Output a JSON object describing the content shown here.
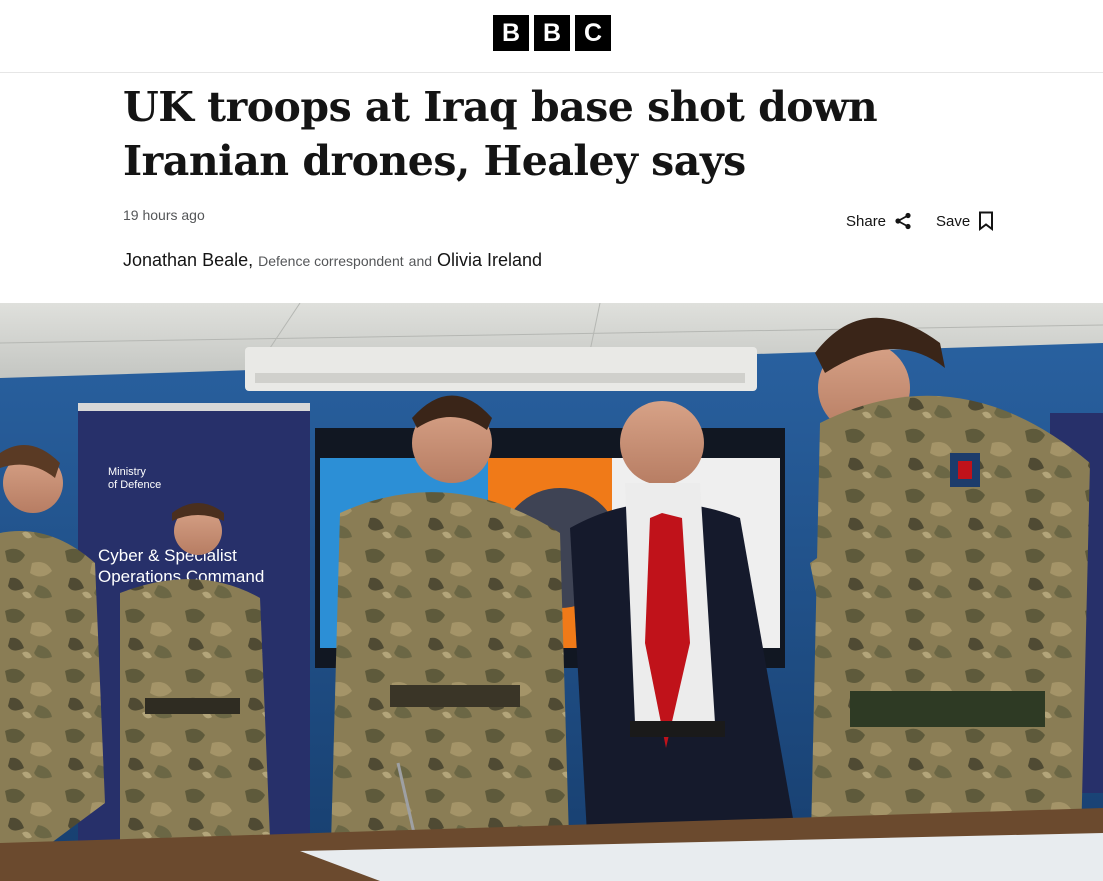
{
  "brand": {
    "logo_letters": [
      "B",
      "B",
      "C"
    ]
  },
  "article": {
    "headline": "UK troops at Iraq base shot down Iranian drones, Healey says",
    "timestamp": "19 hours ago",
    "byline": {
      "author_1": "Jonathan Beale,",
      "author_1_role": "Defence correspondent",
      "conjunction": "and",
      "author_2": "Olivia Ireland"
    }
  },
  "actions": {
    "share_label": "Share",
    "save_label": "Save"
  },
  "hero_image": {
    "banner_org": [
      "Ministry",
      "of Defence"
    ],
    "banner_text": [
      "Cyber & Specialist",
      "Operations Command"
    ]
  },
  "colors": {
    "background": "#ffffff",
    "text": "#141414",
    "meta_text": "#545658",
    "logo": "#000000",
    "tie": "#c0121a",
    "wall": "#1f4f86"
  },
  "icons": {
    "share": "share-icon",
    "save": "bookmark-icon"
  }
}
